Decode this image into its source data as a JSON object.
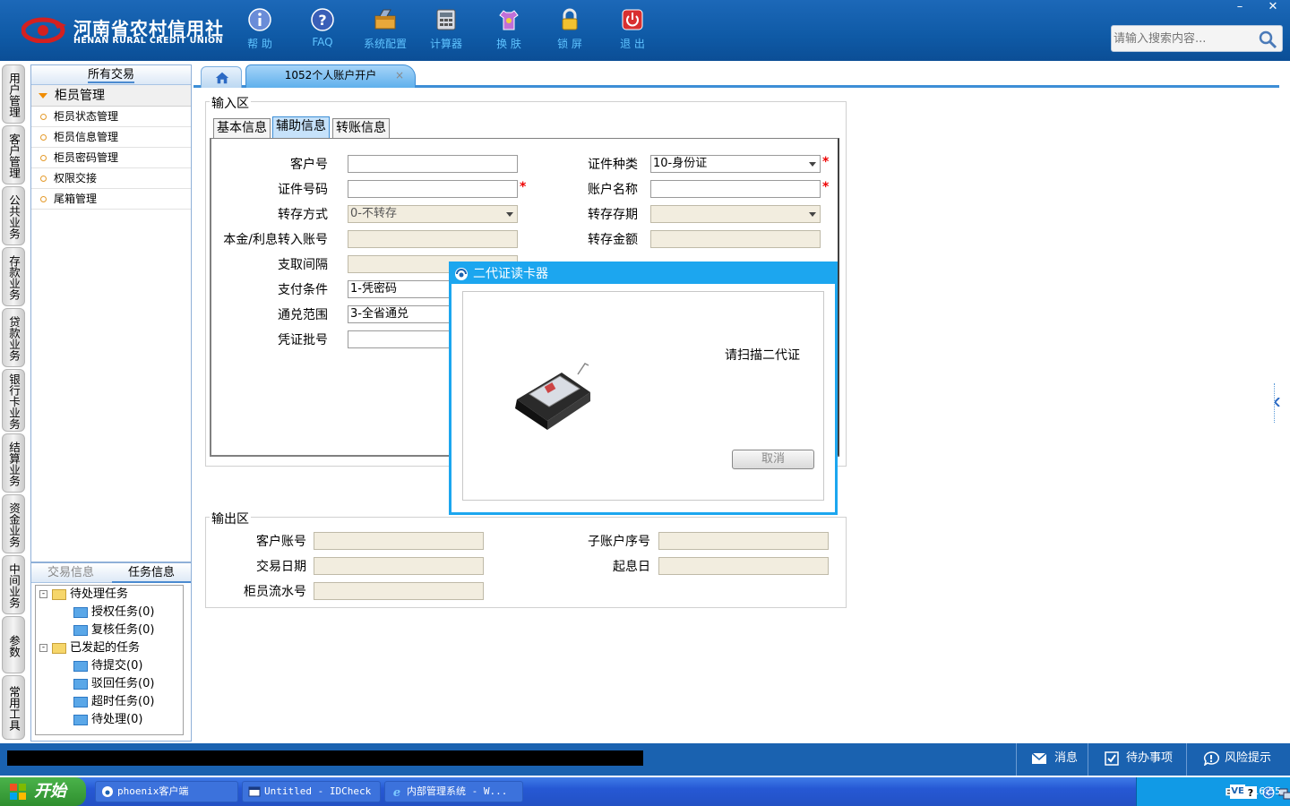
{
  "header": {
    "logo_cn": "河南省农村信用社",
    "logo_en": "HENAN RURAL CREDIT UNION",
    "toolbar": [
      {
        "label": "帮 助",
        "icon": "info-icon"
      },
      {
        "label": "FAQ",
        "icon": "help-icon"
      },
      {
        "label": "系统配置",
        "icon": "toolbox-icon"
      },
      {
        "label": "计算器",
        "icon": "calculator-icon"
      },
      {
        "label": "换 肤",
        "icon": "shirt-icon"
      },
      {
        "label": "锁 屏",
        "icon": "lock-icon"
      },
      {
        "label": "退 出",
        "icon": "power-icon"
      }
    ],
    "search_placeholder": "请输入搜索内容...",
    "window_minimize": "–",
    "window_close": "✕"
  },
  "vertical_tabs": [
    "用户管理",
    "客户管理",
    "公共业务",
    "存款业务",
    "贷款业务",
    "银行卡业务",
    "结算业务",
    "资金业务",
    "中间业务",
    "参数",
    "常用工具"
  ],
  "left_panel": {
    "title": "所有交易",
    "group": "柜员管理",
    "items": [
      "柜员状态管理",
      "柜员信息管理",
      "柜员密码管理",
      "权限交接",
      "尾箱管理"
    ]
  },
  "bottom_panel": {
    "tabs": [
      "交易信息",
      "任务信息"
    ],
    "tree": {
      "pending": "待处理任务",
      "pending_children": [
        "授权任务(0)",
        "复核任务(0)"
      ],
      "initiated": "已发起的任务",
      "initiated_children": [
        "待提交(0)",
        "驳回任务(0)",
        "超时任务(0)",
        "待处理(0)"
      ]
    }
  },
  "main": {
    "active_tab": "1052个人账户开户",
    "tab_close": "×",
    "input_area": {
      "legend": "输入区",
      "inner_tabs": [
        "基本信息",
        "辅助信息",
        "转账信息"
      ],
      "left_labels": [
        "客户号",
        "证件号码",
        "转存方式",
        "本金/利息转入账号",
        "支取间隔",
        "支付条件",
        "通兑范围",
        "凭证批号"
      ],
      "left_values": [
        "",
        "",
        "0-不转存",
        "",
        "",
        "1-凭密码",
        "3-全省通兑",
        ""
      ],
      "right_labels": [
        "证件种类",
        "账户名称",
        "转存存期",
        "转存金额"
      ],
      "right_values": [
        "10-身份证",
        "",
        "",
        ""
      ],
      "required_mark": "*"
    },
    "output_area": {
      "legend": "输出区",
      "left_labels": [
        "客户账号",
        "交易日期",
        "柜员流水号"
      ],
      "right_labels": [
        "子账户序号",
        "起息日"
      ]
    }
  },
  "modal": {
    "title": "二代证读卡器",
    "message": "请扫描二代证",
    "cancel": "取消"
  },
  "status_bar": {
    "buttons": [
      "消息",
      "待办事项",
      "风险提示"
    ]
  },
  "taskbar": {
    "start": "开始",
    "windows": [
      "phoenix客户端",
      "Untitled - IDCheck",
      "内部管理系统 - W..."
    ],
    "clock": "16:55",
    "tray_badge": "VE"
  }
}
